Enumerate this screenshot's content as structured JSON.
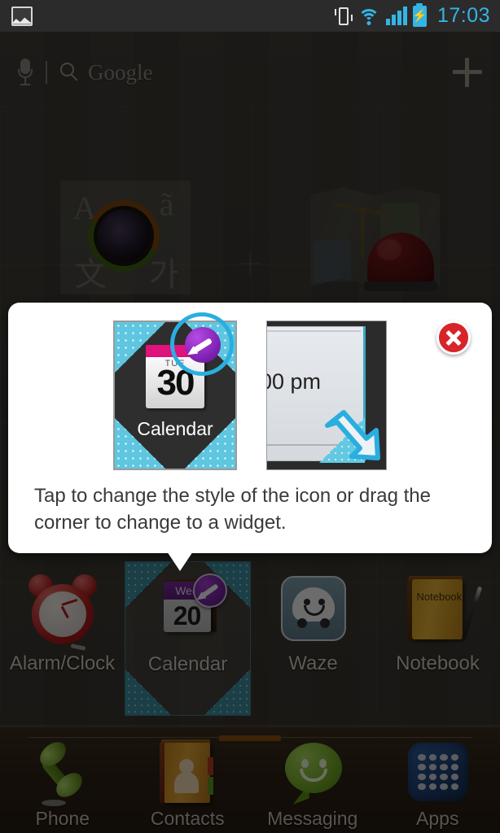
{
  "status_bar": {
    "notification_icon": "screenshot-icon",
    "icons": [
      "vibrate-icon",
      "wifi-icon",
      "signal-icon",
      "battery-charging-icon"
    ],
    "time": "17:03",
    "accent_color": "#33b5e5"
  },
  "search_bar": {
    "mic_icon": "microphone-icon",
    "search_icon": "search-icon",
    "label": "Google",
    "add_icon": "plus-icon"
  },
  "home_widgets": [
    {
      "name": "translate-camera-widget",
      "glyph_a": "A",
      "glyph_b": "ã",
      "glyph_c": "文",
      "glyph_d": "가"
    },
    {
      "name": "map-siren-widget"
    }
  ],
  "app_row": [
    {
      "label": "Alarm/Clock",
      "icon": "alarm-clock-icon",
      "selected": false
    },
    {
      "label": "Calendar",
      "icon": "calendar-icon",
      "selected": true,
      "day_of_week": "Wed",
      "day_number": "20",
      "badge": "brush-badge"
    },
    {
      "label": "Waze",
      "icon": "waze-icon",
      "selected": false
    },
    {
      "label": "Notebook",
      "icon": "notebook-icon",
      "selected": false,
      "cover_text": "Notebook"
    }
  ],
  "dock": [
    {
      "label": "Phone",
      "icon": "phone-handset-icon"
    },
    {
      "label": "Contacts",
      "icon": "contacts-book-icon"
    },
    {
      "label": "Messaging",
      "icon": "message-bubble-icon"
    },
    {
      "label": "Apps",
      "icon": "apps-grid-icon"
    }
  ],
  "dialog": {
    "message": "Tap to change the style of the icon or drag the corner to change to a widget.",
    "close_label": "close-button",
    "preview_icon": {
      "day_of_week": "TUE",
      "day_number": "30",
      "label": "Calendar",
      "badge": "brush-badge",
      "highlight_color": "#2aaee0"
    },
    "preview_widget": {
      "time_text": "00 pm",
      "drag_hint": "drag-corner-arrow"
    }
  },
  "colors": {
    "accent_cyan": "#33b5e5",
    "teal": "#5ec6e0",
    "purple_badge": "#7b1fb0",
    "pink_bar": "#e0127c",
    "close_red": "#d8232a",
    "dialog_bg": "#ffffff"
  }
}
